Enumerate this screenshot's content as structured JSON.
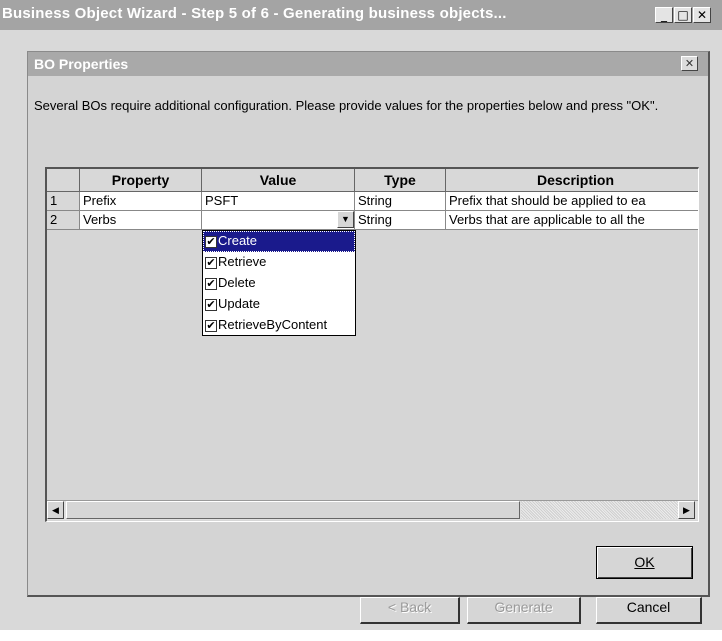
{
  "window": {
    "title": "Business Object Wizard - Step 5 of 6 - Generating business objects...",
    "minimize_glyph": "_",
    "maximize_glyph": "□",
    "close_glyph": "✕"
  },
  "dialog": {
    "title": "BO Properties",
    "close_glyph": "✕",
    "instructions": "Several BOs require additional configuration. Please provide values for the properties below and press \"OK\".",
    "ok_label": "OK"
  },
  "table": {
    "columns": [
      "",
      "Property",
      "Value",
      "Type",
      "Description"
    ],
    "rows": [
      {
        "num": "1",
        "property": "Prefix",
        "value": "PSFT",
        "type": "String",
        "description": "Prefix that should be applied to ea"
      },
      {
        "num": "2",
        "property": "Verbs",
        "value": "",
        "type": "String",
        "description": "Verbs that are applicable to all the"
      }
    ]
  },
  "verbs_dropdown": {
    "arrow_glyph": "▼",
    "check_glyph": "✔",
    "items": [
      {
        "label": "Create",
        "checked": true,
        "selected": true
      },
      {
        "label": "Retrieve",
        "checked": true
      },
      {
        "label": "Delete",
        "checked": true
      },
      {
        "label": "Update",
        "checked": true
      },
      {
        "label": "RetrieveByContent",
        "checked": true
      }
    ]
  },
  "scrollbar": {
    "left_glyph": "◀",
    "right_glyph": "▶"
  },
  "wizard_buttons": {
    "back": "< Back",
    "generate": "Generate",
    "cancel": "Cancel"
  }
}
